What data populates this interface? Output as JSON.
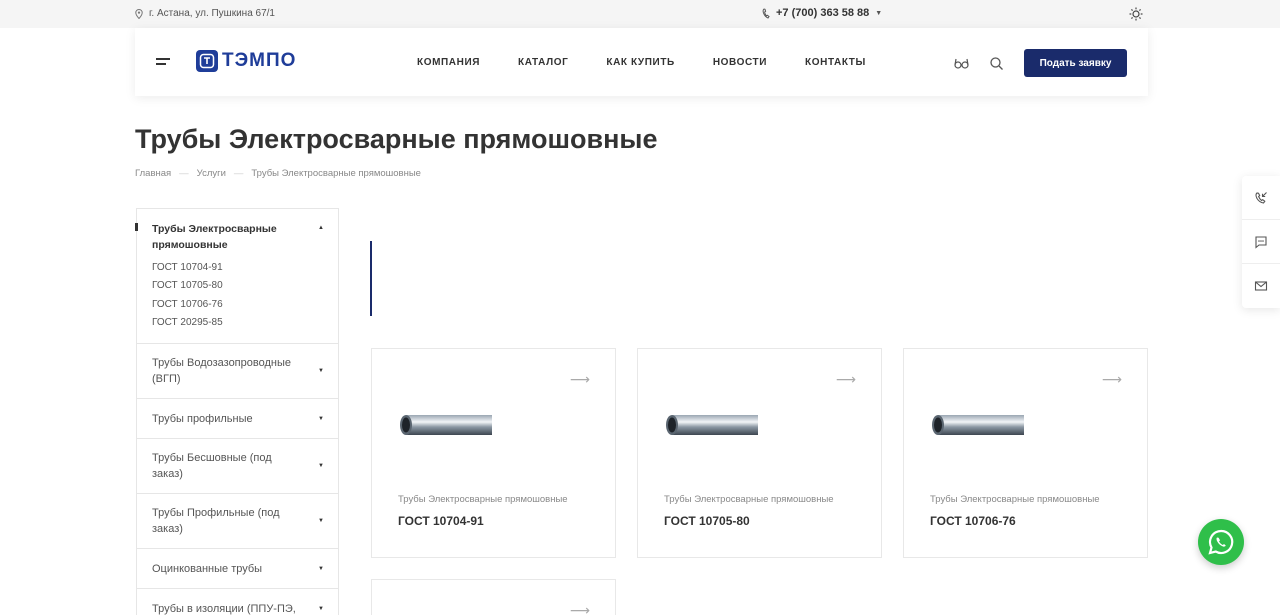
{
  "topbar": {
    "address": "г. Астана, ул. Пушкина 67/1",
    "phone": "+7 (700) 363 58 88"
  },
  "header": {
    "logo_text": "ТЭМПО",
    "nav": [
      "КОМПАНИЯ",
      "КАТАЛОГ",
      "КАК КУПИТЬ",
      "НОВОСТИ",
      "КОНТАКТЫ"
    ],
    "cta_label": "Подать заявку"
  },
  "page": {
    "title": "Трубы Электросварные прямошовные",
    "breadcrumb": [
      "Главная",
      "Услуги",
      "Трубы Электросварные прямошовные"
    ]
  },
  "sidebar": {
    "active": {
      "title": "Трубы Электросварные прямошовные",
      "subitems": [
        "ГОСТ 10704-91",
        "ГОСТ 10705-80",
        "ГОСТ 10706-76",
        "ГОСТ 20295-85"
      ]
    },
    "items": [
      "Трубы Водозазопроводные (ВГП)",
      "Трубы профильные",
      "Трубы Бесшовные (под заказ)",
      "Трубы Профильные (под заказ)",
      "Оцинкованные трубы",
      "Трубы в изоляции (ППУ-ПЭ,"
    ]
  },
  "cards": [
    {
      "category": "Трубы Электросварные прямошовные",
      "name": "ГОСТ 10704-91"
    },
    {
      "category": "Трубы Электросварные прямошовные",
      "name": "ГОСТ 10705-80"
    },
    {
      "category": "Трубы Электросварные прямошовные",
      "name": "ГОСТ 10706-76"
    }
  ],
  "colors": {
    "brand": "#1a2b6b",
    "logo": "#1f3d99",
    "whatsapp": "#2fbf4a"
  },
  "icons": [
    "location-icon",
    "phone-icon",
    "sun-icon",
    "menu-icon",
    "glasses-icon",
    "search-icon",
    "arrow-right-icon",
    "callback-icon",
    "chat-icon",
    "mail-icon",
    "whatsapp-icon"
  ]
}
